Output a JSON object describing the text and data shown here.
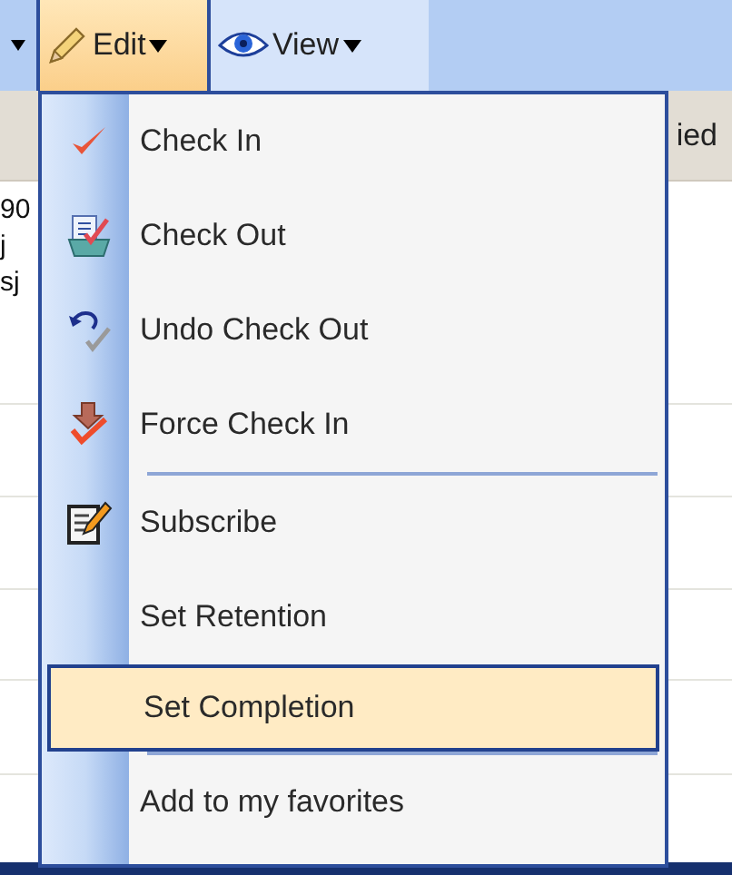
{
  "toolbar": {
    "buttons": [
      {
        "label": "Edit",
        "selected": true
      },
      {
        "label": "View",
        "selected": false
      }
    ]
  },
  "background": {
    "header_text": "ied",
    "cell_texts": [
      "90",
      "j",
      "sj"
    ]
  },
  "menu": {
    "items": [
      {
        "label": "Check In",
        "selected": false,
        "separator_before": false
      },
      {
        "label": "Check Out",
        "selected": false,
        "separator_before": false
      },
      {
        "label": "Undo Check Out",
        "selected": false,
        "separator_before": false
      },
      {
        "label": "Force Check In",
        "selected": false,
        "separator_before": false
      },
      {
        "label": "Subscribe",
        "selected": false,
        "separator_before": true
      },
      {
        "label": "Set Retention",
        "selected": false,
        "separator_before": false
      },
      {
        "label": "Set Completion",
        "selected": true,
        "separator_before": false
      },
      {
        "label": "Add to my favorites",
        "selected": false,
        "separator_before": true
      }
    ]
  }
}
